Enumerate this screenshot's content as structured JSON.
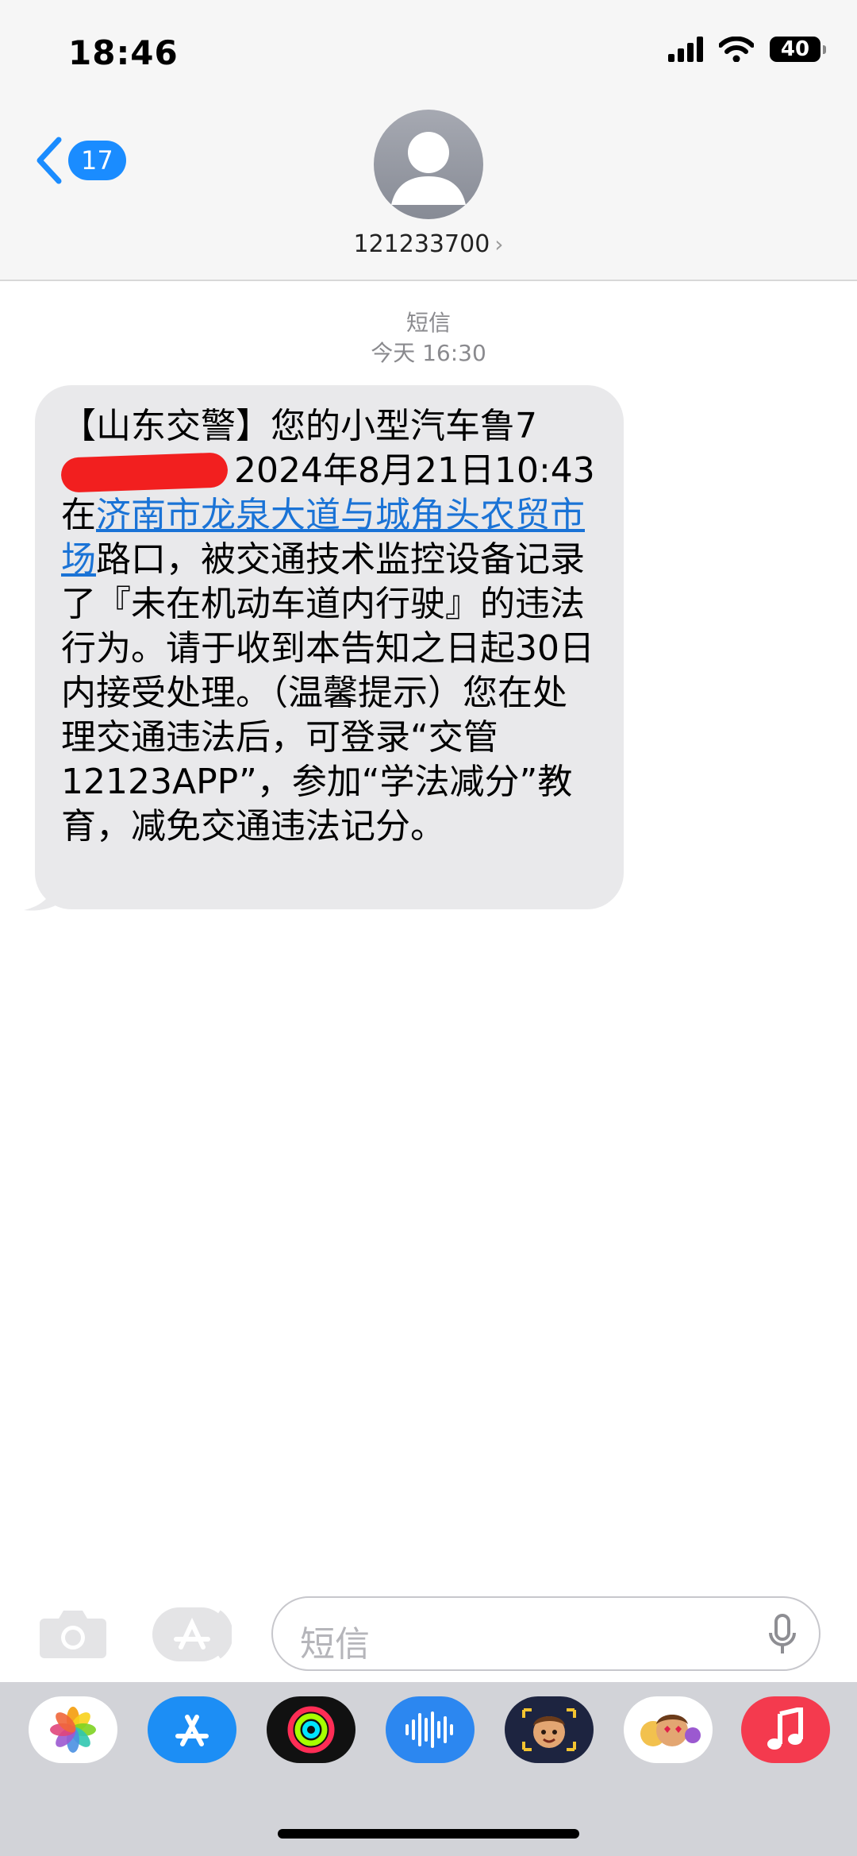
{
  "status_bar": {
    "time": "18:46",
    "battery": "40"
  },
  "header": {
    "back_badge": "17",
    "contact_number": "121233700",
    "contact_chevron": "›"
  },
  "thread": {
    "service_label": "短信",
    "timestamp": "今天 16:30"
  },
  "message": {
    "part1": "【山东交警】您的小型汽车鲁",
    "plate_prefix": "7",
    "part2": "2024年8月21日10:43在",
    "location_link": "济南市龙泉大道与城角头农贸市场",
    "part3": "路口，被交通技术监控设备记录了『未在机动车道内行驶』的违法行为。请于收到本告知之日起30日内接受处理。（温馨提示）您在处理交通违法后，可登录“交管12123APP”，参加“学法减分”教育，减免交通违法记分。"
  },
  "composer": {
    "placeholder": "短信"
  },
  "dock_apps": [
    "photos-icon",
    "app-store-icon",
    "fitness-icon",
    "voice-memos-icon",
    "memoji-icon",
    "memoji-stickers-icon",
    "music-icon"
  ],
  "colors": {
    "link": "#1a73d6",
    "badge": "#1a8cff",
    "bubble": "#e9e9eb",
    "redaction": "#f21f1f"
  }
}
